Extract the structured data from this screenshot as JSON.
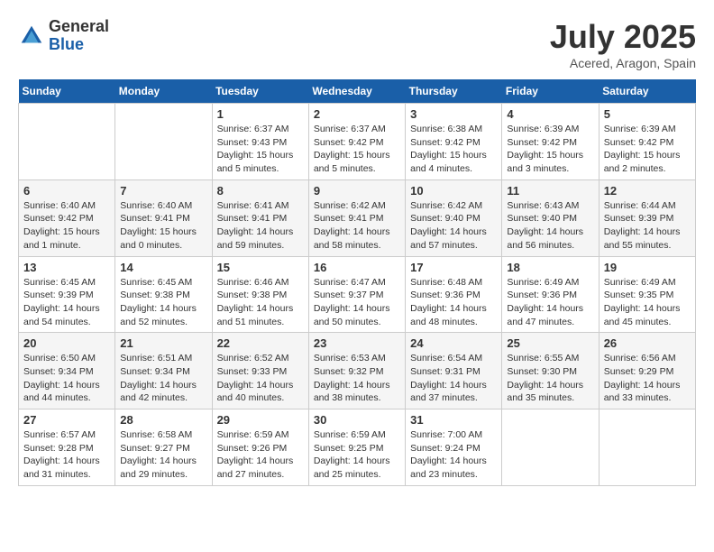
{
  "header": {
    "logo_general": "General",
    "logo_blue": "Blue",
    "title": "July 2025",
    "location": "Acered, Aragon, Spain"
  },
  "weekdays": [
    "Sunday",
    "Monday",
    "Tuesday",
    "Wednesday",
    "Thursday",
    "Friday",
    "Saturday"
  ],
  "weeks": [
    [
      {
        "day": "",
        "detail": ""
      },
      {
        "day": "",
        "detail": ""
      },
      {
        "day": "1",
        "detail": "Sunrise: 6:37 AM\nSunset: 9:43 PM\nDaylight: 15 hours and 5 minutes."
      },
      {
        "day": "2",
        "detail": "Sunrise: 6:37 AM\nSunset: 9:42 PM\nDaylight: 15 hours and 5 minutes."
      },
      {
        "day": "3",
        "detail": "Sunrise: 6:38 AM\nSunset: 9:42 PM\nDaylight: 15 hours and 4 minutes."
      },
      {
        "day": "4",
        "detail": "Sunrise: 6:39 AM\nSunset: 9:42 PM\nDaylight: 15 hours and 3 minutes."
      },
      {
        "day": "5",
        "detail": "Sunrise: 6:39 AM\nSunset: 9:42 PM\nDaylight: 15 hours and 2 minutes."
      }
    ],
    [
      {
        "day": "6",
        "detail": "Sunrise: 6:40 AM\nSunset: 9:42 PM\nDaylight: 15 hours and 1 minute."
      },
      {
        "day": "7",
        "detail": "Sunrise: 6:40 AM\nSunset: 9:41 PM\nDaylight: 15 hours and 0 minutes."
      },
      {
        "day": "8",
        "detail": "Sunrise: 6:41 AM\nSunset: 9:41 PM\nDaylight: 14 hours and 59 minutes."
      },
      {
        "day": "9",
        "detail": "Sunrise: 6:42 AM\nSunset: 9:41 PM\nDaylight: 14 hours and 58 minutes."
      },
      {
        "day": "10",
        "detail": "Sunrise: 6:42 AM\nSunset: 9:40 PM\nDaylight: 14 hours and 57 minutes."
      },
      {
        "day": "11",
        "detail": "Sunrise: 6:43 AM\nSunset: 9:40 PM\nDaylight: 14 hours and 56 minutes."
      },
      {
        "day": "12",
        "detail": "Sunrise: 6:44 AM\nSunset: 9:39 PM\nDaylight: 14 hours and 55 minutes."
      }
    ],
    [
      {
        "day": "13",
        "detail": "Sunrise: 6:45 AM\nSunset: 9:39 PM\nDaylight: 14 hours and 54 minutes."
      },
      {
        "day": "14",
        "detail": "Sunrise: 6:45 AM\nSunset: 9:38 PM\nDaylight: 14 hours and 52 minutes."
      },
      {
        "day": "15",
        "detail": "Sunrise: 6:46 AM\nSunset: 9:38 PM\nDaylight: 14 hours and 51 minutes."
      },
      {
        "day": "16",
        "detail": "Sunrise: 6:47 AM\nSunset: 9:37 PM\nDaylight: 14 hours and 50 minutes."
      },
      {
        "day": "17",
        "detail": "Sunrise: 6:48 AM\nSunset: 9:36 PM\nDaylight: 14 hours and 48 minutes."
      },
      {
        "day": "18",
        "detail": "Sunrise: 6:49 AM\nSunset: 9:36 PM\nDaylight: 14 hours and 47 minutes."
      },
      {
        "day": "19",
        "detail": "Sunrise: 6:49 AM\nSunset: 9:35 PM\nDaylight: 14 hours and 45 minutes."
      }
    ],
    [
      {
        "day": "20",
        "detail": "Sunrise: 6:50 AM\nSunset: 9:34 PM\nDaylight: 14 hours and 44 minutes."
      },
      {
        "day": "21",
        "detail": "Sunrise: 6:51 AM\nSunset: 9:34 PM\nDaylight: 14 hours and 42 minutes."
      },
      {
        "day": "22",
        "detail": "Sunrise: 6:52 AM\nSunset: 9:33 PM\nDaylight: 14 hours and 40 minutes."
      },
      {
        "day": "23",
        "detail": "Sunrise: 6:53 AM\nSunset: 9:32 PM\nDaylight: 14 hours and 38 minutes."
      },
      {
        "day": "24",
        "detail": "Sunrise: 6:54 AM\nSunset: 9:31 PM\nDaylight: 14 hours and 37 minutes."
      },
      {
        "day": "25",
        "detail": "Sunrise: 6:55 AM\nSunset: 9:30 PM\nDaylight: 14 hours and 35 minutes."
      },
      {
        "day": "26",
        "detail": "Sunrise: 6:56 AM\nSunset: 9:29 PM\nDaylight: 14 hours and 33 minutes."
      }
    ],
    [
      {
        "day": "27",
        "detail": "Sunrise: 6:57 AM\nSunset: 9:28 PM\nDaylight: 14 hours and 31 minutes."
      },
      {
        "day": "28",
        "detail": "Sunrise: 6:58 AM\nSunset: 9:27 PM\nDaylight: 14 hours and 29 minutes."
      },
      {
        "day": "29",
        "detail": "Sunrise: 6:59 AM\nSunset: 9:26 PM\nDaylight: 14 hours and 27 minutes."
      },
      {
        "day": "30",
        "detail": "Sunrise: 6:59 AM\nSunset: 9:25 PM\nDaylight: 14 hours and 25 minutes."
      },
      {
        "day": "31",
        "detail": "Sunrise: 7:00 AM\nSunset: 9:24 PM\nDaylight: 14 hours and 23 minutes."
      },
      {
        "day": "",
        "detail": ""
      },
      {
        "day": "",
        "detail": ""
      }
    ]
  ]
}
